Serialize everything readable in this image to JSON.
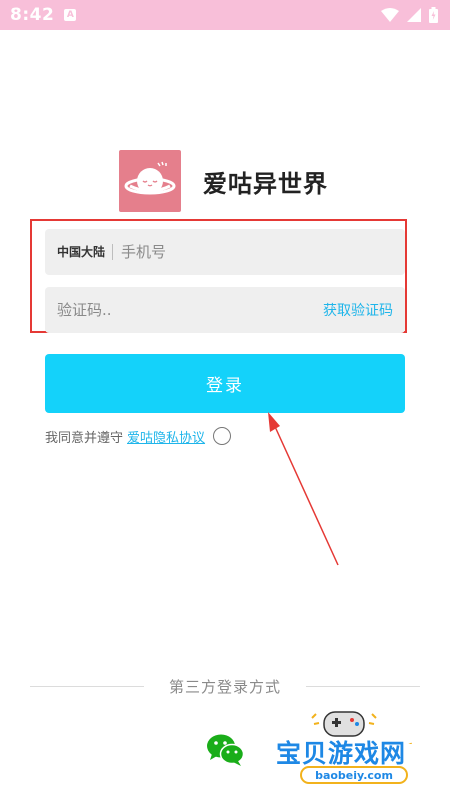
{
  "status_bar": {
    "time": "8:42",
    "notification_badge": "A"
  },
  "app": {
    "name": "爱咕异世界",
    "logo_icon": "planet-icon",
    "accent_color": "#14d2fa",
    "logo_color": "#e57f8c"
  },
  "form": {
    "region_label": "中国大陆",
    "phone_placeholder": "手机号",
    "code_placeholder": "验证码..",
    "get_code_label": "获取验证码"
  },
  "login_button": {
    "label": "登录"
  },
  "agreement": {
    "prefix": "我同意并遵守",
    "link_text": "爱咕隐私协议"
  },
  "third_party": {
    "title": "第三方登录方式",
    "wechat_icon": "wechat-icon"
  },
  "watermark": {
    "text": "宝贝游戏网",
    "url": "baobeiy.com"
  }
}
